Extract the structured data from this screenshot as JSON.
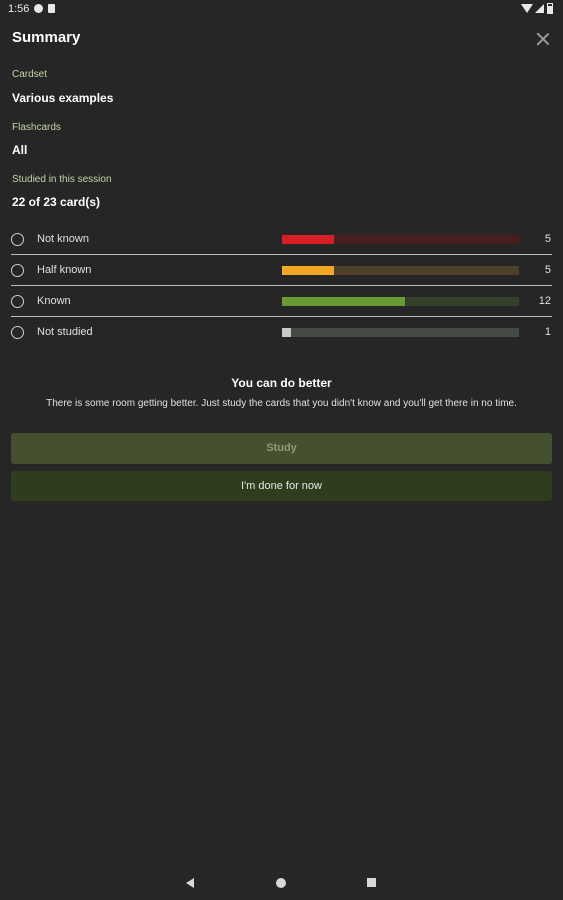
{
  "status_bar": {
    "time": "1:56",
    "icons": [
      "notification-icon",
      "sim-icon",
      "wifi-icon",
      "signal-icon",
      "battery-icon"
    ]
  },
  "header": {
    "title": "Summary",
    "close_icon": "close-icon"
  },
  "fields": {
    "cardset": {
      "label": "Cardset",
      "value": "Various examples"
    },
    "flashcards": {
      "label": "Flashcards",
      "value": "All"
    },
    "studied": {
      "label": "Studied in this session",
      "value": "22 of 23 card(s)"
    }
  },
  "stats": [
    {
      "label": "Not known",
      "count": "5",
      "fraction": 0.22,
      "color": "#d81f26",
      "track": "#4a1d1f"
    },
    {
      "label": "Half known",
      "count": "5",
      "fraction": 0.22,
      "color": "#f5a623",
      "track": "#4d3f28"
    },
    {
      "label": "Known",
      "count": "12",
      "fraction": 0.52,
      "color": "#6a9a33",
      "track": "#33402a"
    },
    {
      "label": "Not studied",
      "count": "1",
      "fraction": 0.04,
      "color": "#c8c8c8",
      "track": "#444a44"
    }
  ],
  "result": {
    "title": "You can do better",
    "text": "There is some room getting better. Just study the cards that you didn't know and you'll get there in no time."
  },
  "buttons": {
    "study": "Study",
    "done": "I'm done for now"
  },
  "nav": {
    "icons": [
      "back-icon",
      "home-icon",
      "recents-icon"
    ]
  }
}
